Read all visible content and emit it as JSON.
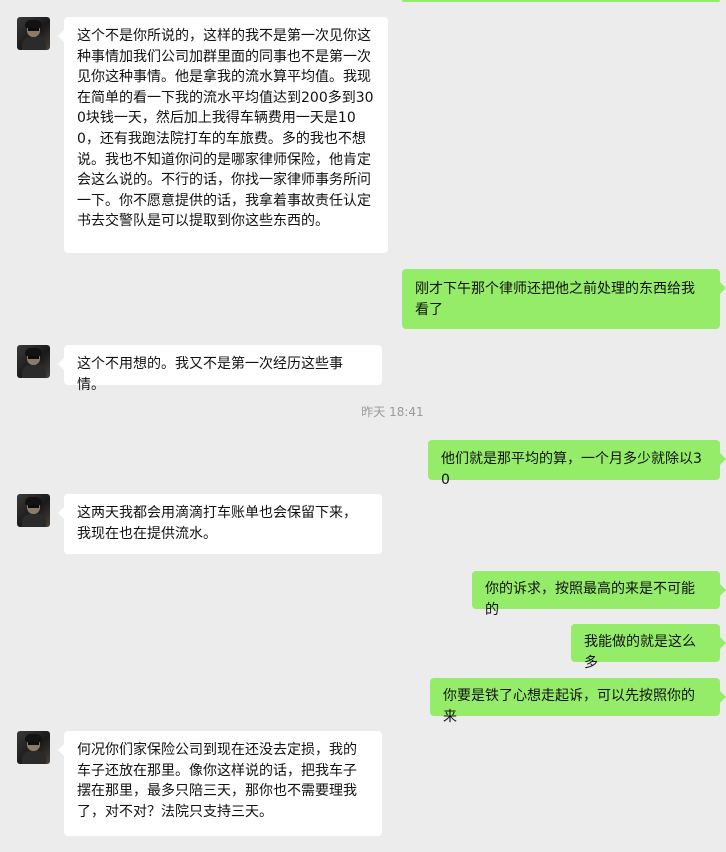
{
  "conversation": {
    "timestamp": "昨天 18:41",
    "contact_avatar": "avatar-photo",
    "messages": [
      {
        "side": "left",
        "text": "这个不是你所说的，这样的我不是第一次见你这种事情加我们公司加群里面的同事也不是第一次见你这种事情。他是拿我的流水算平均值。我现在简单的看一下我的流水平均值达到200多到300块钱一天，然后加上我得车辆费用一天是100，还有我跑法院打车的车旅费。多的我也不想说。我也不知道你问的是哪家律师保险，他肯定会这么说的。不行的话，你找一家律师事务所问一下。你不愿意提供的话，我拿着事故责任认定书去交警队是可以提取到你这些东西的。"
      },
      {
        "side": "right",
        "text": "刚才下午那个律师还把他之前处理的东西给我看了"
      },
      {
        "side": "left",
        "text": "这个不用想的。我又不是第一次经历这些事情。"
      },
      {
        "side": "right",
        "text": "他们就是那平均的算，一个月多少就除以30"
      },
      {
        "side": "left",
        "text": "这两天我都会用滴滴打车账单也会保留下来，我现在也在提供流水。"
      },
      {
        "side": "right",
        "text": "你的诉求，按照最高的来是不可能的"
      },
      {
        "side": "right",
        "text": "我能做的就是这么多"
      },
      {
        "side": "right",
        "text": "你要是铁了心想走起诉，可以先按照你的来"
      },
      {
        "side": "left",
        "text": "何况你们家保险公司到现在还没去定损，我的车子还放在那里。像你这样说的话，把我车子摆在那里，最多只陪三天，那你也不需要理我了，对不对？法院只支持三天。"
      }
    ]
  }
}
